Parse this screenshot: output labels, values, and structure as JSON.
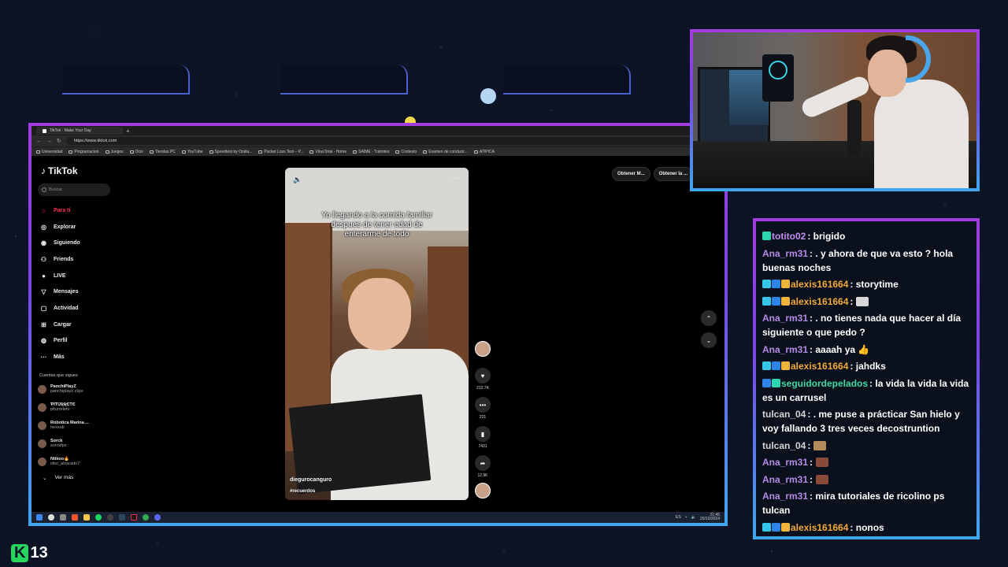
{
  "overlay": {
    "logo_k": "K",
    "logo_num": "13"
  },
  "browser": {
    "tab_title": "TikTok - Make Your Day",
    "new_tab": "+",
    "url": "https://www.tiktok.com",
    "bookmarks": [
      "Universidad",
      "Programacion",
      "Juegos",
      "Ocio",
      "Tiendas PC",
      "YouTube",
      "Speedtest by Ookla...",
      "Packet Loss Test – P...",
      "VirusTotal - Home",
      "SAIME - Trámites",
      "Contesto",
      "Examen de conducir...",
      "ATIPICA"
    ]
  },
  "tiktok": {
    "logo": "TikTok",
    "search_placeholder": "Buscar",
    "menu": [
      {
        "label": "Para ti",
        "icon": "home-icon"
      },
      {
        "label": "Explorar",
        "icon": "compass-icon"
      },
      {
        "label": "Siguiendo",
        "icon": "following-icon"
      },
      {
        "label": "Friends",
        "icon": "friends-icon"
      },
      {
        "label": "LIVE",
        "icon": "live-icon"
      },
      {
        "label": "Mensajes",
        "icon": "messages-icon",
        "badge": "66"
      },
      {
        "label": "Actividad",
        "icon": "activity-icon"
      },
      {
        "label": "Cargar",
        "icon": "upload-icon"
      },
      {
        "label": "Perfil",
        "icon": "profile-icon"
      },
      {
        "label": "Más",
        "icon": "more-icon"
      }
    ],
    "following_title": "Cuentas que sigues",
    "following": [
      {
        "name": "PanchiPlayZ",
        "handle": "panchiplayz.clips"
      },
      {
        "name": "ƤƖƬƲƦƦЄƬЄ",
        "handle": "piturretetv"
      },
      {
        "name": "Robotica Marina ...",
        "handle": "nexsub"
      },
      {
        "name": "Sorck",
        "handle": "sorckfps"
      },
      {
        "name": "Ntikoo🔥",
        "handle": "niko_alvarado7"
      }
    ],
    "see_more": "Ver más",
    "top_buttons": [
      "Obtener M...",
      "Obtener la ..."
    ],
    "video": {
      "caption": "Yo llegando a la comida familiar despues de tener edad de enterarme de todo",
      "author": "diegurocanguro",
      "hashtag": "#recuerdos",
      "likes": "212.7K",
      "comments": "221",
      "saves": "7431",
      "shares": "12.9K"
    }
  },
  "taskbar": {
    "lang": "ES",
    "time": "21:45",
    "date": "20/10/2024"
  },
  "chat": [
    {
      "badges": [
        "b-teal"
      ],
      "user": "totito02",
      "color": "#c68cf2",
      "text": ": brigido"
    },
    {
      "badges": [],
      "user": "Ana_rm31",
      "color": "#b58ae6",
      "text": ": . y ahora de que va esto ? hola buenas noches"
    },
    {
      "badges": [
        "b-cyan",
        "b-blue",
        "b-gold"
      ],
      "user": "alexis161664",
      "color": "#f2a93b",
      "text": ": storytime"
    },
    {
      "badges": [
        "b-cyan",
        "b-blue",
        "b-gold"
      ],
      "user": "alexis161664",
      "color": "#f2a93b",
      "text": ":",
      "emote": "#d8d8d8"
    },
    {
      "badges": [],
      "user": "Ana_rm31",
      "color": "#b58ae6",
      "text": ": . no tienes nada que hacer al día siguiente o que pedo ?"
    },
    {
      "badges": [],
      "user": "Ana_rm31",
      "color": "#b58ae6",
      "text": ": aaaah ya 👍"
    },
    {
      "badges": [
        "b-cyan",
        "b-blue",
        "b-gold"
      ],
      "user": "alexis161664",
      "color": "#f2a93b",
      "text": ": jahdks"
    },
    {
      "badges": [
        "b-blue",
        "b-teal"
      ],
      "user": "seguidordepelados",
      "color": "#3fd7a6",
      "text": ": la vida la vida la vida es un carrusel"
    },
    {
      "badges": [],
      "user": "tulcan_04",
      "color": "#d4d4d4",
      "text": ": . me puse a prácticar San hielo y voy fallando 3 tres veces decostruntion"
    },
    {
      "badges": [],
      "user": "tulcan_04",
      "color": "#d4d4d4",
      "text": ":",
      "emote": "#b38a5a"
    },
    {
      "badges": [],
      "user": "Ana_rm31",
      "color": "#b58ae6",
      "text": ":",
      "emote": "#8a4a3a"
    },
    {
      "badges": [],
      "user": "Ana_rm31",
      "color": "#b58ae6",
      "text": ":",
      "emote": "#8a4a3a"
    },
    {
      "badges": [],
      "user": "Ana_rm31",
      "color": "#b58ae6",
      "text": ": mira tutoriales de ricolino ps tulcan"
    },
    {
      "badges": [
        "b-cyan",
        "b-blue",
        "b-gold"
      ],
      "user": "alexis161664",
      "color": "#f2a93b",
      "text": ": nonos"
    }
  ]
}
